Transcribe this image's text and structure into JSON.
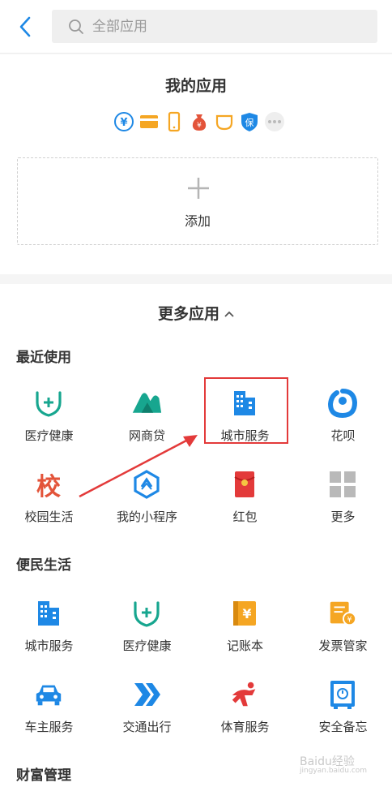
{
  "search": {
    "placeholder": "全部应用"
  },
  "my_apps": {
    "title": "我的应用",
    "add_label": "添加",
    "mini_icons": [
      "yuan-icon",
      "card-icon",
      "phone-icon",
      "money-bag-icon",
      "cup-icon",
      "insurance-icon",
      "more-dots-icon"
    ]
  },
  "more_apps": {
    "title": "更多应用",
    "sections": [
      {
        "title": "最近使用"
      },
      {
        "title": "便民生活"
      },
      {
        "title": "财富管理"
      }
    ],
    "recent": [
      {
        "label": "医疗健康",
        "icon": "medical-heart-icon"
      },
      {
        "label": "网商贷",
        "icon": "mountain-icon"
      },
      {
        "label": "城市服务",
        "icon": "city-building-icon"
      },
      {
        "label": "花呗",
        "icon": "huabei-icon"
      },
      {
        "label": "校园生活",
        "icon": "school-icon",
        "glyph": "校"
      },
      {
        "label": "我的小程序",
        "icon": "mini-program-icon"
      },
      {
        "label": "红包",
        "icon": "red-envelope-icon"
      },
      {
        "label": "更多",
        "icon": "grid-more-icon"
      }
    ],
    "life": [
      {
        "label": "城市服务",
        "icon": "city-building-icon"
      },
      {
        "label": "医疗健康",
        "icon": "medical-heart-icon"
      },
      {
        "label": "记账本",
        "icon": "ledger-icon"
      },
      {
        "label": "发票管家",
        "icon": "invoice-icon"
      },
      {
        "label": "车主服务",
        "icon": "car-icon"
      },
      {
        "label": "交通出行",
        "icon": "transit-arrow-icon"
      },
      {
        "label": "体育服务",
        "icon": "sports-icon"
      },
      {
        "label": "安全备忘",
        "icon": "safe-icon"
      }
    ]
  },
  "watermark": {
    "text": "Baidu经验",
    "sub": "jingyan.baidu.com"
  },
  "colors": {
    "accent": "#1e88e5",
    "green": "#17a68f",
    "red": "#e33a3a",
    "orange": "#f5a623"
  }
}
